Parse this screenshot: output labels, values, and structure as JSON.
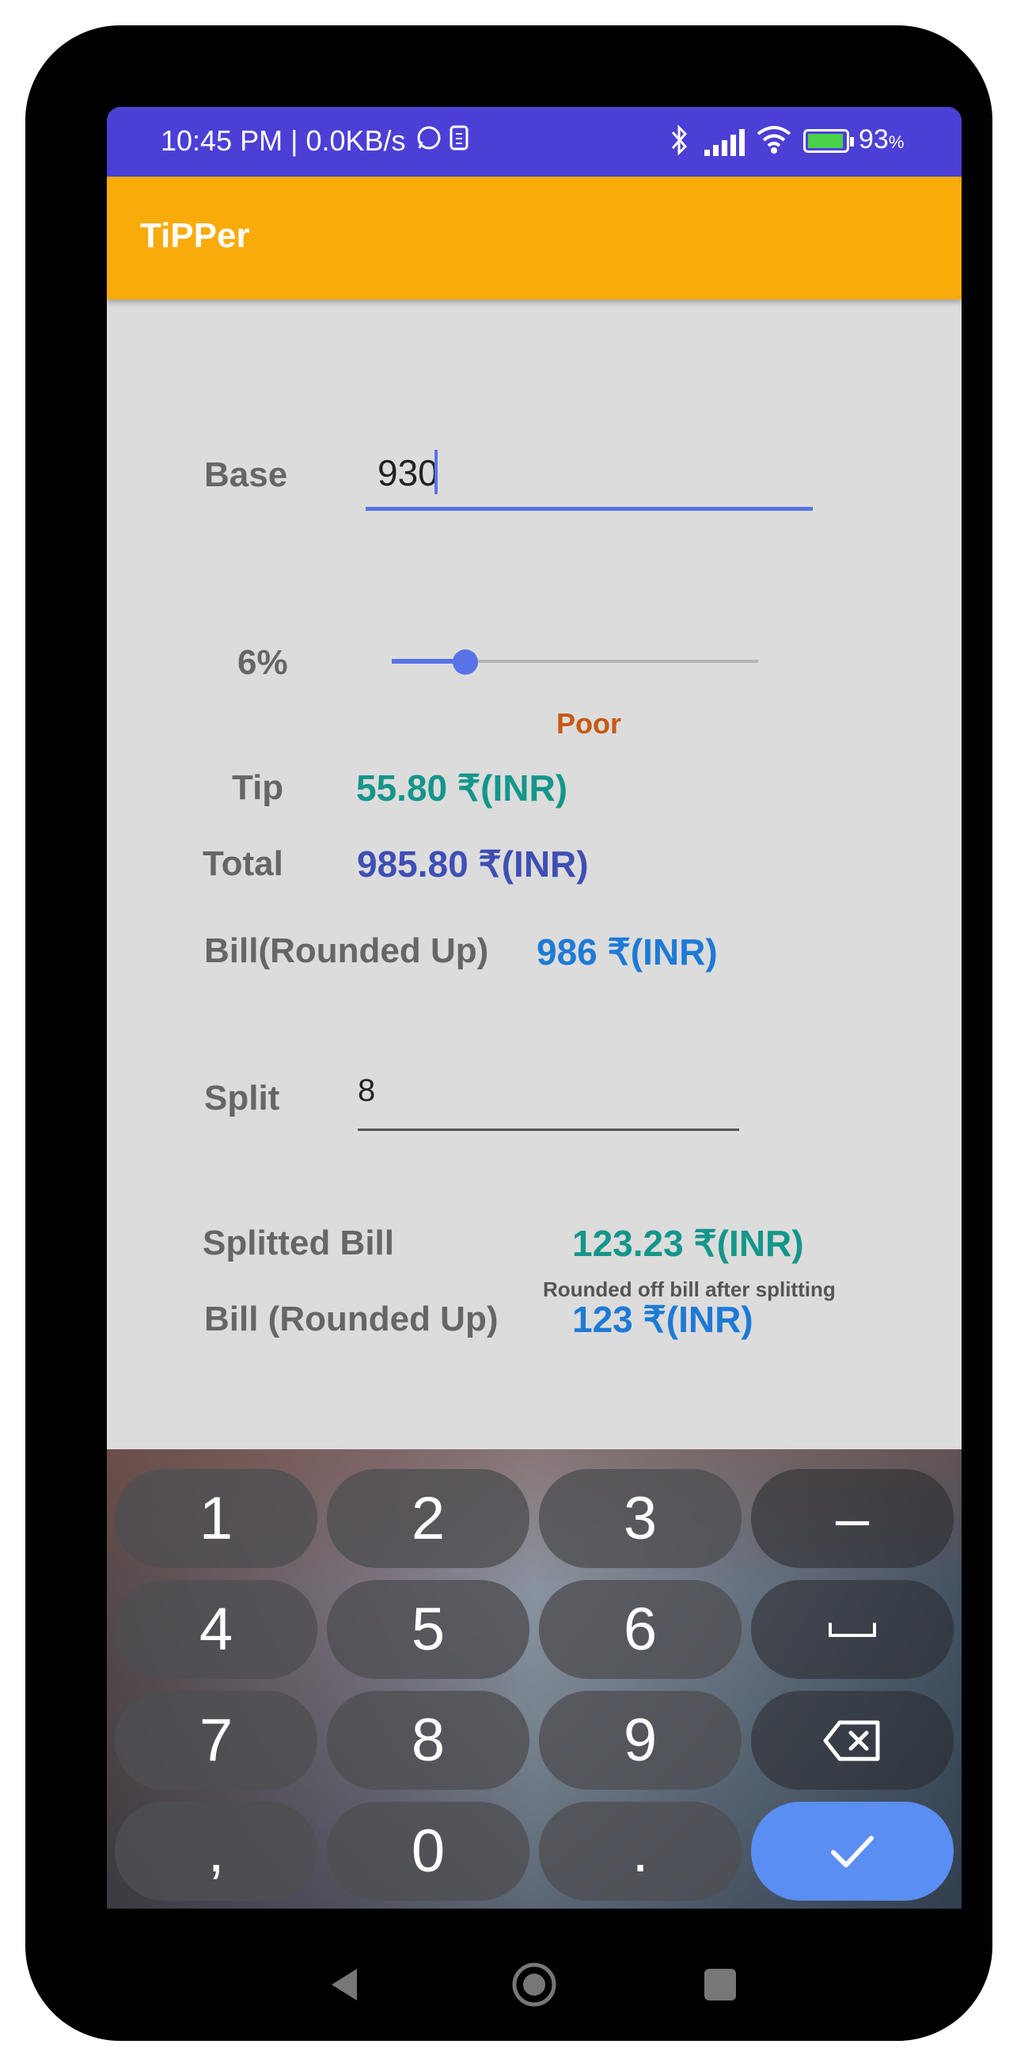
{
  "status_bar": {
    "time_text": "10:45 PM | 0.0KB/s",
    "battery": "93",
    "battery_unit": "%"
  },
  "app": {
    "title": "TiPPer"
  },
  "form": {
    "base_label": "Base",
    "base_value": "930",
    "tip_percent_label": "6%",
    "tip_percent_value": 6,
    "slider_max": 30,
    "rating_text": "Poor",
    "tip_label": "Tip",
    "tip_value": "55.80 ₹(INR)",
    "total_label": "Total",
    "total_value": "985.80 ₹(INR)",
    "bill_rounded_label": "Bill(Rounded Up)",
    "bill_rounded_value": "986 ₹(INR)",
    "split_label": "Split",
    "split_value": "8",
    "splitted_bill_label": "Splitted Bill",
    "splitted_bill_value": "123.23 ₹(INR)",
    "split_rounded_label": "Bill (Rounded Up)",
    "split_rounded_value": "123 ₹(INR)",
    "split_note": "Rounded off bill after splitting"
  },
  "keyboard": {
    "keys": [
      "1",
      "2",
      "3",
      "–",
      "4",
      "5",
      "6",
      "7",
      "8",
      "9",
      ",",
      "0",
      "."
    ]
  },
  "colors": {
    "status_bar": "#4c3fd6",
    "app_bar": "#f9ab0a",
    "accent": "#5873e6",
    "tip_value": "#14968a",
    "total_value": "#3f4fb5",
    "rounded_value": "#1e7ad6",
    "rating": "#c7590f"
  }
}
